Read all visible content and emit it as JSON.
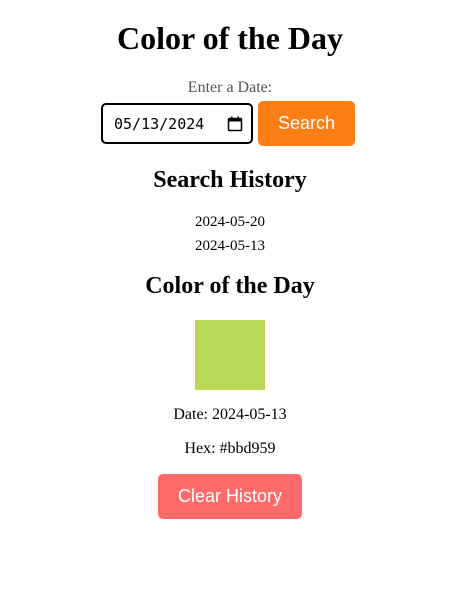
{
  "header": {
    "title": "Color of the Day"
  },
  "search": {
    "label": "Enter a Date:",
    "input_value": "05/13/2024",
    "button_label": "Search",
    "button_color": "#fd7e14"
  },
  "history": {
    "heading": "Search History",
    "items": [
      "2024-05-20",
      "2024-05-13"
    ]
  },
  "result": {
    "heading": "Color of the Day",
    "swatch_color": "#bbd959",
    "date_label": "Date: 2024-05-13",
    "hex_label": "Hex: #bbd959"
  },
  "actions": {
    "clear_label": "Clear History",
    "clear_color": "#ff6b6b"
  },
  "icons": {
    "calendar": "calendar-icon"
  }
}
